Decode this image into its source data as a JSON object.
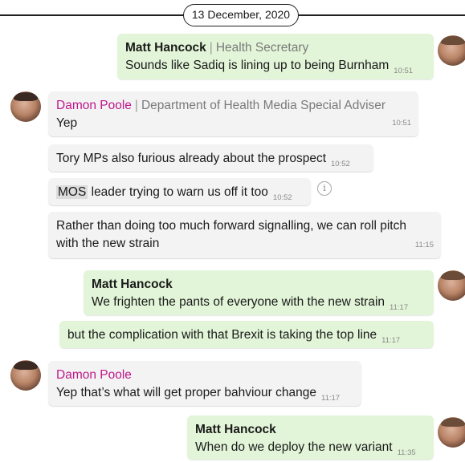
{
  "date_label": "13 December, 2020",
  "people": {
    "matt": {
      "name": "Matt Hancock",
      "role": "Health Secretary"
    },
    "damon": {
      "name": "Damon Poole",
      "role": "Department of Health Media Special Adviser"
    }
  },
  "messages": [
    {
      "text": "Sounds like Sadiq is lining up to being Burnham",
      "time": "10:51"
    },
    {
      "text": "Yep",
      "time": "10:51"
    },
    {
      "text": "Tory MPs also furious already about the prospect",
      "time": "10:52"
    },
    {
      "highlight": "MOS",
      "text": " leader trying to warn us off it too",
      "time": "10:52"
    },
    {
      "line1": "Rather than doing too much forward signalling, we can roll pitch",
      "line2": "with the new strain",
      "time": "11:15"
    },
    {
      "text": "We frighten the pants of everyone with the new strain",
      "time": "11:17"
    },
    {
      "text": "but the complication with that Brexit is taking the top line",
      "time": "11:17"
    },
    {
      "text": "Yep that’s what will get proper bahviour change",
      "time": "11:17"
    },
    {
      "text": "When do we deploy the new variant",
      "time": "11:35"
    }
  ],
  "icons": {
    "info": "i",
    "separator": "|"
  }
}
